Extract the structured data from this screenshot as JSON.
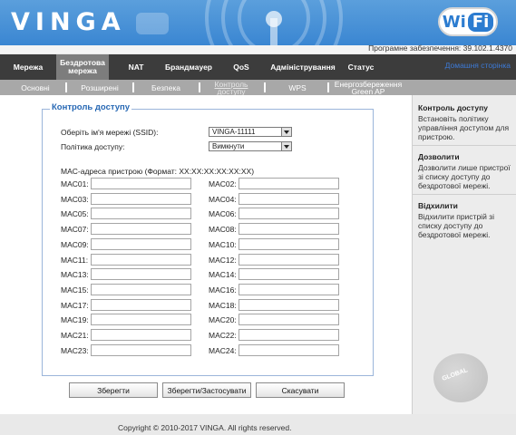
{
  "header": {
    "brand": "VINGA",
    "wifi_logo": {
      "wi": "Wi",
      "fi": "Fi"
    },
    "firmware": "Програмне забезпечення: 39.102.1.4370",
    "accent_color": "#3a86d2"
  },
  "mainnav": {
    "items": [
      {
        "label": "Мережа"
      },
      {
        "label": "Бездротова мережа"
      },
      {
        "label": "NAT"
      },
      {
        "label": "Брандмауер"
      },
      {
        "label": "QoS"
      },
      {
        "label": "Адміністрування"
      },
      {
        "label": "Статус"
      }
    ],
    "active_index": 1,
    "home_link": "Домашня сторінка"
  },
  "subnav": {
    "items": [
      {
        "label": "Основні"
      },
      {
        "label": "Розширені"
      },
      {
        "label": "Безпека"
      },
      {
        "label": "Контроль доступу"
      },
      {
        "label": "WPS"
      },
      {
        "label": "Енергозбереження Green AP"
      }
    ],
    "active_index": 3
  },
  "form": {
    "legend": "Контроль доступу",
    "ssid_label": "Оберіть ім'я мережі (SSID):",
    "ssid_value": "VINGA-11111",
    "policy_label": "Політика доступу:",
    "policy_value": "Вимкнути",
    "mac_section_label": "MAC-адреса пристрою (Формат: XX:XX:XX:XX:XX:XX)",
    "mac_labels": [
      "MAC01:",
      "MAC02:",
      "MAC03:",
      "MAC04:",
      "MAC05:",
      "MAC06:",
      "MAC07:",
      "MAC08:",
      "MAC09:",
      "MAC10:",
      "MAC11:",
      "MAC12:",
      "MAC13:",
      "MAC14:",
      "MAC15:",
      "MAC16:",
      "MAC17:",
      "MAC18:",
      "MAC19:",
      "MAC20:",
      "MAC21:",
      "MAC22:",
      "MAC23:",
      "MAC24:"
    ]
  },
  "buttons": {
    "save": "Зберегти",
    "save_apply": "Зберегти/Застосувати",
    "cancel": "Скасувати"
  },
  "help": {
    "sections": [
      {
        "title": "Контроль доступу",
        "text": "Встановіть політику управління доступом для пристрою."
      },
      {
        "title": "Дозволити",
        "text": "Дозволити лише пристрої зі списку доступу до бездротової мережі."
      },
      {
        "title": "Відхилити",
        "text": "Відхилити пристрій зі списку доступу до бездротової мережі."
      }
    ],
    "watermark": "GLOBAL"
  },
  "footer": {
    "copyright": "Copyright © 2010-2017 VINGA. All rights reserved."
  }
}
